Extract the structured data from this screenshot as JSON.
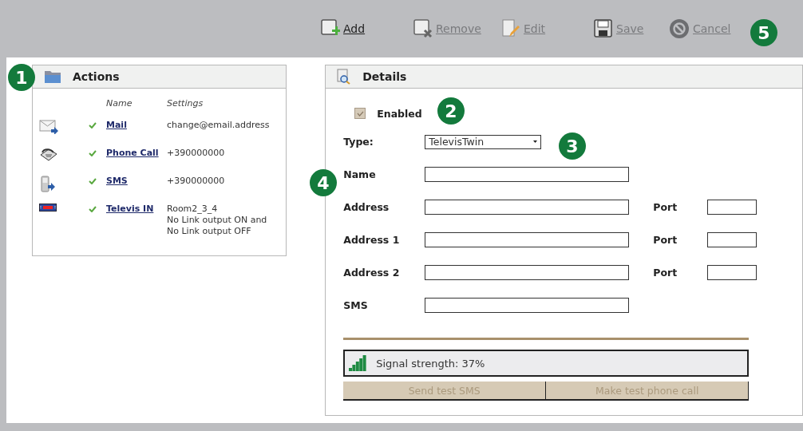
{
  "toolbar": [
    {
      "kind": "add",
      "label": "Add",
      "disabled": false
    },
    {
      "kind": "remove",
      "label": "Remove",
      "disabled": true
    },
    {
      "kind": "edit",
      "label": "Edit",
      "disabled": true
    },
    {
      "kind": "save",
      "label": "Save",
      "disabled": true
    },
    {
      "kind": "cancel",
      "label": "Cancel",
      "disabled": true
    }
  ],
  "actions": {
    "title": "Actions",
    "columns": [
      "Name",
      "Settings"
    ],
    "rows": [
      {
        "kind": "mail",
        "checked": true,
        "name": "Mail",
        "settings": [
          "change@email.address"
        ]
      },
      {
        "kind": "phone",
        "checked": true,
        "name": "Phone Call",
        "settings": [
          "+390000000"
        ]
      },
      {
        "kind": "sms",
        "checked": true,
        "name": "SMS",
        "settings": [
          "+390000000"
        ]
      },
      {
        "kind": "televis",
        "checked": true,
        "name": "Televis IN",
        "settings": [
          "Room2_3_4",
          "No Link output ON and",
          "No Link output OFF"
        ]
      }
    ]
  },
  "details": {
    "title": "Details",
    "enabled": {
      "label": "Enabled",
      "checked": true
    },
    "type": {
      "label": "Type:",
      "value": "TelevisTwin"
    },
    "fields": [
      {
        "label": "Name"
      },
      {
        "label": "Address",
        "port": "Port"
      },
      {
        "label": "Address 1",
        "port": "Port"
      },
      {
        "label": "Address 2",
        "port": "Port"
      },
      {
        "label": "SMS"
      }
    ],
    "signal": "Signal strength: 37%",
    "buttons": [
      {
        "label": "Send test SMS",
        "disabled": true
      },
      {
        "label": "Make test phone call",
        "disabled": true
      }
    ]
  },
  "callouts": [
    "1",
    "2",
    "3",
    "4",
    "5"
  ]
}
